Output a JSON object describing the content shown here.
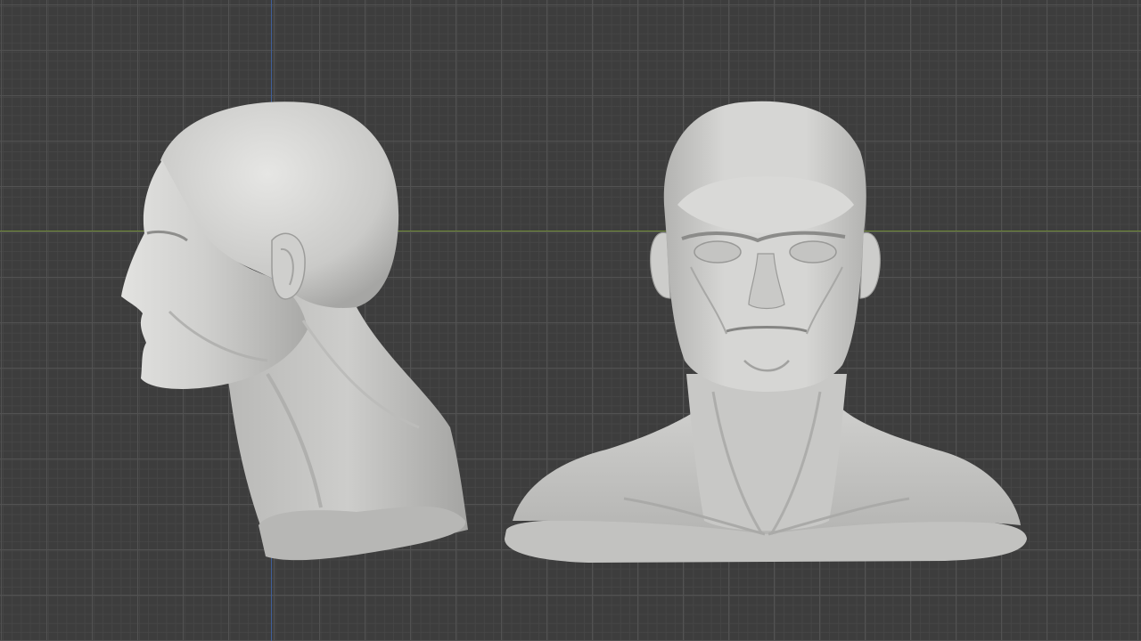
{
  "viewport": {
    "background_color": "#3d3d3d",
    "grid_minor_color": "#464646",
    "grid_major_color": "#525252",
    "x_axis_color": "#6f8a36",
    "y_axis_color": "#3f5f9a",
    "mesh_color": "#c9cac8"
  },
  "objects": [
    {
      "name": "head-side-view",
      "icon": "sculpt-mesh"
    },
    {
      "name": "bust-front-view",
      "icon": "sculpt-mesh"
    }
  ]
}
